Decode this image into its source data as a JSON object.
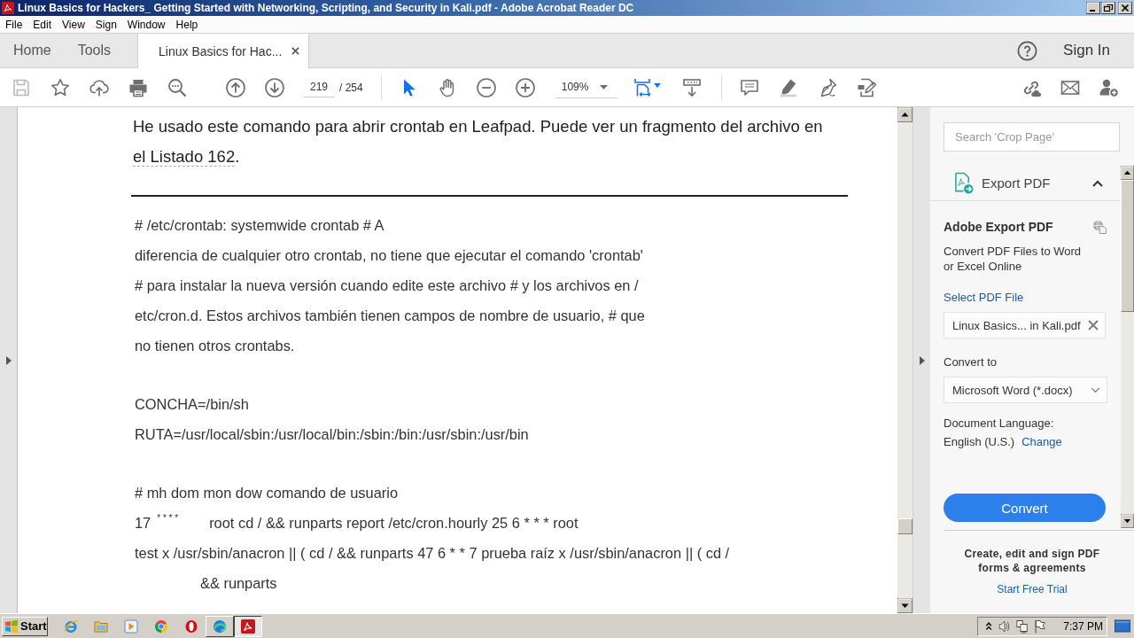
{
  "window": {
    "title": "Linux Basics for Hackers_ Getting Started with Networking, Scripting, and Security in Kali.pdf - Adobe Acrobat Reader DC"
  },
  "menu_bar": [
    "File",
    "Edit",
    "View",
    "Sign",
    "Window",
    "Help"
  ],
  "tabs": [
    {
      "label": "Home",
      "selected": false,
      "closable": false
    },
    {
      "label": "Tools",
      "selected": false,
      "closable": false
    },
    {
      "label": "Linux Basics for Hac...",
      "selected": true,
      "closable": true
    }
  ],
  "account": {
    "label": "Sign In"
  },
  "toolbar": {
    "save": {
      "disabled": true
    },
    "page": "219",
    "page_total": "/ 254",
    "tools": [
      {
        "kind": "select",
        "selected": true
      },
      {
        "kind": "hand",
        "selected": false
      }
    ],
    "zoom": "109%"
  },
  "document": {
    "paragraph": {
      "text": "He usado este comando para abrir crontab en Leafpad. Puede ver un fragmento del archivo en",
      "link": "el Listado 162",
      "after": "."
    },
    "listing": [
      {
        "lines": [
          {
            "kind": "plain",
            "text": "# /etc/crontab: systemwide crontab # A"
          },
          {
            "kind": "plain",
            "text": "diferencia de cualquier otro crontab, no tiene que ejecutar el comando 'crontab'"
          },
          {
            "kind": "plain",
            "text": "# para instalar la nueva versión cuando edite este archivo # y los archivos en /"
          },
          {
            "kind": "plain",
            "text": "etc/cron.d. Estos archivos también tienen campos de nombre de usuario, # que"
          },
          {
            "kind": "plain",
            "text": "no tienen otros crontabs."
          }
        ]
      },
      {
        "lines": [
          {
            "kind": "plain",
            "text": "CONCHA=/bin/sh"
          },
          {
            "kind": "plain",
            "text": "RUTA=/usr/local/sbin:/usr/local/bin:/sbin:/bin:/usr/sbin:/usr/bin"
          }
        ]
      },
      {
        "lines": [
          {
            "kind": "plain",
            "text": "# mh dom mon dow comando de usuario"
          },
          {
            "kind": "schedule",
            "minute": "17",
            "fields": "* * * *",
            "command": "root cd / && runparts report /etc/cron.hourly 25 6 * * * root"
          },
          {
            "kind": "plain",
            "text": "test x /usr/sbin/anacron || ( cd / && runparts 47 6 * * 7 prueba raíz x /usr/sbin/anacron || ( cd /"
          },
          {
            "kind": "continuation",
            "text": "&& runparts"
          }
        ]
      }
    ]
  },
  "side_panel": {
    "search": {
      "placeholder": "Search 'Crop Page'"
    },
    "section": {
      "title": "Export PDF",
      "expanded": true,
      "heading": "Adobe Export PDF",
      "description": "Convert PDF Files to Word or Excel Online",
      "select_link": "Select PDF File",
      "file": "Linux Basics... in Kali.pdf",
      "convert_label": "Convert to",
      "format": "Microsoft Word (*.docx)",
      "language_label": "Document Language:",
      "language": "English (U.S.)",
      "language_link": "Change",
      "button": "Convert"
    },
    "promo": {
      "text": "Create, edit and sign PDF forms & agreements",
      "link": "Start Free Trial"
    }
  },
  "taskbar": {
    "start": "Start",
    "quick_launch": [
      {
        "kind": "ie"
      },
      {
        "kind": "explorer"
      },
      {
        "kind": "media"
      },
      {
        "kind": "chrome"
      },
      {
        "kind": "opera"
      }
    ],
    "windows": [
      {
        "kind": "edge",
        "selected": false
      },
      {
        "kind": "acrobat",
        "selected": true
      }
    ],
    "clock": "7:37 PM"
  }
}
